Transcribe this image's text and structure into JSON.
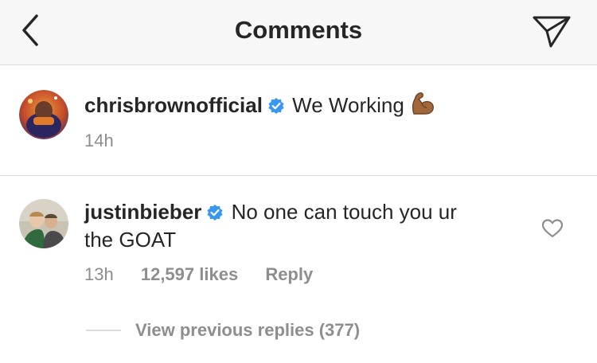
{
  "header": {
    "title": "Comments",
    "back_icon": "chevron-left-icon",
    "send_icon": "paper-plane-icon"
  },
  "comments": [
    {
      "username": "chrisbrownofficial",
      "verified": true,
      "text": "We Working",
      "emoji": "flexed-biceps",
      "time": "14h"
    }
  ],
  "reply": {
    "username": "justinbieber",
    "verified": true,
    "text_line1": "No one can touch you ur",
    "text_line2": "the GOAT",
    "time": "13h",
    "likes": "12,597 likes",
    "reply_label": "Reply",
    "like_icon": "heart-outline-icon",
    "view_replies_label": "View previous replies (377)"
  },
  "colors": {
    "text": "#262626",
    "secondary": "#8e8e8e",
    "verified": "#3897f0",
    "divider": "#dbdbdb",
    "header_bg": "#f7f7f7"
  }
}
